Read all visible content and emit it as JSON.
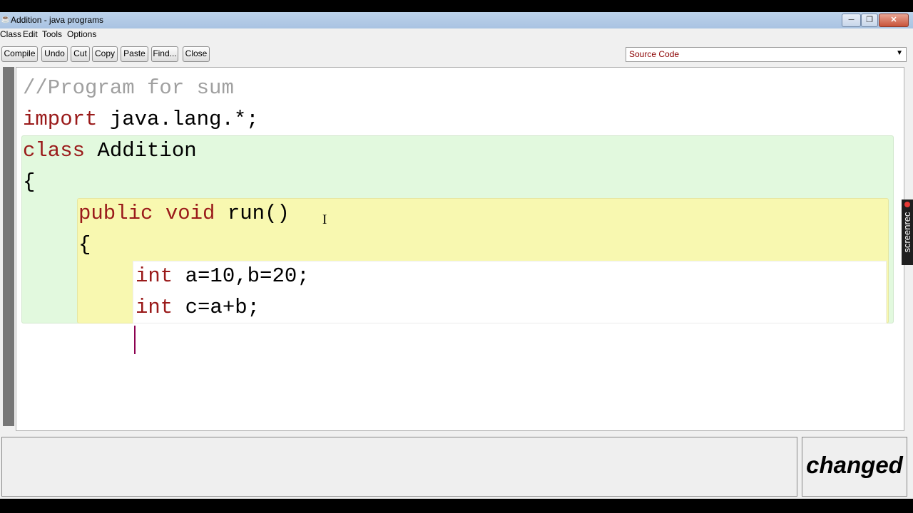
{
  "window": {
    "title": "Addition - java programs",
    "minimize": "─",
    "maximize": "❐",
    "close": "✕"
  },
  "menu": [
    "Class",
    "Edit",
    "Tools",
    "Options"
  ],
  "toolbar": {
    "buttons": [
      "Compile",
      "Undo",
      "Cut",
      "Copy",
      "Paste",
      "Find...",
      "Close"
    ],
    "view_select": "Source Code"
  },
  "editor": {
    "lines": [
      "//Program for sum",
      "import java.lang.*;",
      "class Addition",
      "{",
      "public void run()",
      "{",
      "int a=10,b=20;",
      "int c=a+b;"
    ]
  },
  "watermark": "screenrec",
  "status": "changed",
  "colors": {
    "class_scope": "#e2f9de",
    "method_scope": "#f8f8b0",
    "keyword": "#9a1a1a",
    "comment": "#a0a0a0"
  }
}
